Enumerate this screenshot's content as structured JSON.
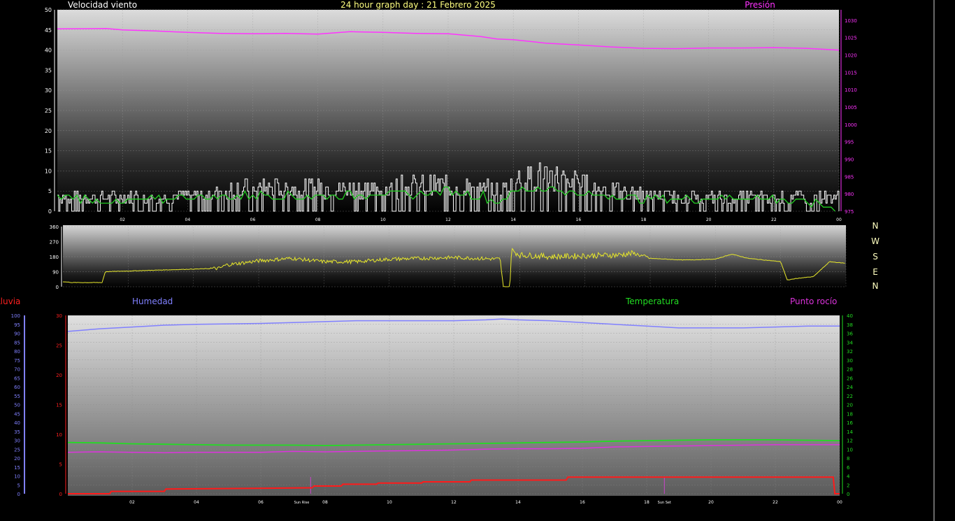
{
  "header": {
    "left_title": "Velocidad viento",
    "center_title": "24 hour graph day : 21 Febrero 2025",
    "right_title": "Presión"
  },
  "compass": {
    "labels": [
      "N",
      "W",
      "S",
      "E",
      "N"
    ]
  },
  "bottom_legend": {
    "rain": "Lluvia",
    "humidity": "Humedad",
    "temperature": "Temperatura",
    "dewpoint": "Punto rocío"
  },
  "sun_marks": {
    "sunrise": "Sun Rise",
    "sunset": "Sun Set"
  },
  "colors": {
    "wind_gust": "#ffffff",
    "wind_avg": "#22cc22",
    "pressure": "#ff33ff",
    "direction": "#e6e62a",
    "humidity": "#8080ff",
    "temperature": "#22dd22",
    "dewpoint": "#dd33dd",
    "rain": "#ff1a1a",
    "title_yellow": "#ffff80",
    "rain_axis": "#ff2020"
  },
  "chart_data": [
    {
      "type": "line",
      "name": "wind_pressure",
      "x_ticks": [
        "02",
        "04",
        "06",
        "08",
        "10",
        "12",
        "14",
        "16",
        "18",
        "20",
        "22",
        "00"
      ],
      "y_left_ticks": [
        "0",
        "5",
        "10",
        "15",
        "20",
        "25",
        "30",
        "35",
        "40",
        "45",
        "50"
      ],
      "y_right_ticks": [
        "975",
        "980",
        "985",
        "990",
        "995",
        "1000",
        "1005",
        "1010",
        "1015",
        "1020",
        "1025",
        "1030"
      ],
      "ylim_left": [
        0,
        50
      ],
      "ylim_right": [
        975,
        1033
      ],
      "xlim": [
        0,
        24
      ],
      "pressure": {
        "x": [
          0,
          1.5,
          2,
          3,
          4,
          5,
          6,
          7,
          8,
          9,
          10,
          11,
          12,
          13,
          13.5,
          14,
          15,
          16,
          17,
          18,
          19,
          20,
          21,
          22,
          23,
          24
        ],
        "y": [
          1027.5,
          1027.6,
          1027.2,
          1026.9,
          1026.5,
          1026.2,
          1026.1,
          1026.2,
          1026.0,
          1026.7,
          1026.5,
          1026.2,
          1026.1,
          1025.3,
          1024.6,
          1024.4,
          1023.4,
          1022.9,
          1022.3,
          1021.9,
          1021.8,
          1022.0,
          1022.0,
          1022.1,
          1021.9,
          1021.4
        ]
      },
      "wind_gust_envelope": {
        "x": [
          0,
          2,
          3,
          4,
          6,
          7,
          8,
          9,
          10,
          11,
          12,
          13,
          13.5,
          14,
          15,
          16,
          17,
          18,
          19,
          20,
          22,
          23,
          24
        ],
        "y": [
          5,
          5,
          5,
          6,
          8,
          8,
          8,
          8,
          8,
          9,
          9,
          8,
          7,
          11,
          13,
          10,
          7,
          6,
          5,
          5,
          5,
          5,
          5
        ]
      },
      "wind_avg": {
        "x": [
          0,
          1,
          2,
          3,
          4,
          5,
          6,
          7,
          8,
          9,
          10,
          11,
          12,
          13,
          13.5,
          14,
          15,
          16,
          17,
          18,
          19,
          20,
          21,
          22,
          23,
          24
        ],
        "y": [
          3.5,
          3,
          2,
          3,
          3.5,
          3.5,
          4,
          3.5,
          4,
          4,
          4.5,
          4,
          5,
          4,
          2,
          5,
          6,
          4,
          4,
          3,
          3,
          3,
          3.5,
          3,
          2,
          1
        ]
      }
    },
    {
      "type": "line",
      "name": "wind_direction",
      "y_ticks": [
        "0",
        "90",
        "180",
        "270",
        "360"
      ],
      "ylim": [
        0,
        360
      ],
      "xlim": [
        0,
        24
      ],
      "direction": {
        "x": [
          0,
          0.3,
          1.2,
          1.3,
          3,
          4.8,
          5,
          6,
          7,
          8,
          9,
          10,
          11,
          12,
          13.4,
          13.5,
          13.7,
          13.75,
          14,
          15,
          16,
          17,
          17.5,
          18,
          19,
          20,
          20.5,
          21,
          21.5,
          22,
          22.2,
          22.5,
          23,
          23.5,
          24
        ],
        "y": [
          30,
          25,
          25,
          90,
          100,
          110,
          130,
          155,
          170,
          150,
          150,
          165,
          170,
          175,
          165,
          0,
          0,
          220,
          190,
          180,
          185,
          190,
          200,
          170,
          160,
          165,
          195,
          170,
          160,
          150,
          40,
          50,
          60,
          150,
          140
        ]
      }
    },
    {
      "type": "line",
      "name": "temp_hum_rain",
      "x_ticks": [
        "02",
        "04",
        "06",
        "08",
        "10",
        "12",
        "14",
        "16",
        "18",
        "20",
        "22",
        "00"
      ],
      "rain_ticks": [
        "0",
        "5",
        "10",
        "15",
        "20",
        "25",
        "30"
      ],
      "humidity_ticks": [
        "0",
        "5",
        "10",
        "15",
        "20",
        "25",
        "30",
        "35",
        "40",
        "45",
        "50",
        "55",
        "60",
        "65",
        "70",
        "75",
        "80",
        "85",
        "90",
        "95",
        "100"
      ],
      "temp_ticks": [
        "0",
        "2",
        "4",
        "6",
        "8",
        "10",
        "12",
        "14",
        "16",
        "18",
        "20",
        "22",
        "24",
        "26",
        "28",
        "30",
        "32",
        "34",
        "36",
        "38",
        "40"
      ],
      "ylim_rain": [
        0,
        30
      ],
      "ylim_humidity": [
        0,
        100
      ],
      "ylim_temp": [
        0,
        40
      ],
      "xlim": [
        0,
        24
      ],
      "humidity": {
        "x": [
          0,
          1,
          2,
          3,
          4,
          6,
          7,
          8,
          9,
          10,
          11,
          12,
          13,
          13.5,
          14,
          15,
          16,
          17,
          18,
          19,
          20,
          21,
          22,
          23,
          24
        ],
        "y": [
          91,
          92.5,
          93.5,
          94.5,
          95,
          95.5,
          96,
          96.5,
          97,
          97,
          97,
          97,
          97.5,
          98,
          97.5,
          97,
          96,
          95,
          94,
          93,
          93,
          93,
          93.5,
          94,
          94
        ]
      },
      "temperature": {
        "x": [
          0,
          1,
          2,
          3,
          4,
          5,
          6,
          7,
          8,
          9,
          10,
          11,
          12,
          13,
          14,
          15,
          16,
          17,
          18,
          19,
          20,
          21,
          22,
          23,
          24
        ],
        "y": [
          11.5,
          11.4,
          11.2,
          11.1,
          11,
          10.9,
          10.9,
          10.9,
          10.8,
          10.9,
          11.0,
          11.1,
          11.2,
          11.3,
          11.4,
          11.5,
          11.6,
          11.8,
          11.9,
          12.0,
          12.1,
          12.1,
          12.1,
          12.0,
          11.9
        ]
      },
      "dewpoint": {
        "x": [
          0,
          1,
          2,
          3,
          4,
          5,
          6,
          7,
          8,
          9,
          10,
          11,
          12,
          13,
          14,
          15,
          16,
          17,
          18,
          19,
          20,
          21,
          22,
          23,
          24
        ],
        "y": [
          9.3,
          9.4,
          9.3,
          9.2,
          9.3,
          9.3,
          9.3,
          9.5,
          9.4,
          9.5,
          9.6,
          9.7,
          9.8,
          10.0,
          10.1,
          10.1,
          10.2,
          10.5,
          10.6,
          10.7,
          10.8,
          10.9,
          11.0,
          11.0,
          11.0
        ]
      },
      "rain": {
        "x": [
          0,
          1.3,
          1.35,
          3,
          3.05,
          5.5,
          7.6,
          7.65,
          8.5,
          8.55,
          9.6,
          9.65,
          11,
          11.05,
          12.5,
          12.55,
          15.5,
          15.55,
          23.8,
          23.85,
          24
        ],
        "y": [
          0,
          0,
          0.4,
          0.4,
          0.8,
          0.9,
          1.0,
          1.3,
          1.3,
          1.6,
          1.6,
          1.8,
          1.8,
          2.0,
          2.0,
          2.3,
          2.3,
          2.8,
          2.8,
          0,
          0
        ]
      },
      "sunrise_hour": 7.55,
      "sunset_hour": 18.55
    }
  ]
}
